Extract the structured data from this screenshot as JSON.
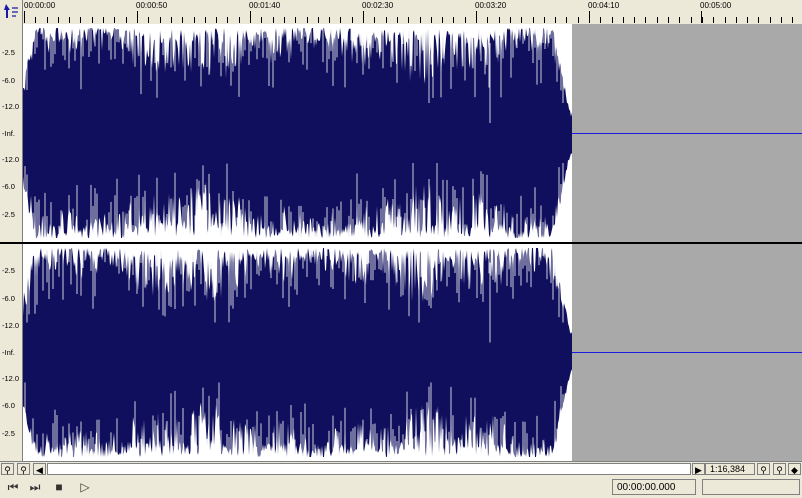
{
  "timeline": {
    "labels": [
      "00:00:00",
      "00:00:50",
      "00:01:40",
      "00:02:30",
      "00:03:20",
      "00:04:10",
      "00:05:00"
    ]
  },
  "db_scale": {
    "top": [
      "-2.5",
      "-6.0",
      "-12.0",
      "-Inf.",
      "-12.0",
      "-6.0",
      "-2.5"
    ],
    "bottom": [
      "-2.5",
      "-6.0",
      "-12.0",
      "-Inf.",
      "-12.0",
      "-6.0",
      "-2.5"
    ]
  },
  "zoom": {
    "label": "1:16,384"
  },
  "position": {
    "value": "00:00:00.000"
  },
  "colors": {
    "waveform": "#0f0f5e",
    "silence": "#a9a9a9",
    "baseline": "#1c1ce0",
    "chrome": "#ece9d8"
  },
  "icons": {
    "corner": "cursor-tool-icon",
    "zoom_in": "zoom-in-icon",
    "zoom_out": "zoom-out-icon",
    "scroll_left": "arrow-left-icon",
    "scroll_right": "arrow-right-icon",
    "go_start": "skip-start-icon",
    "go_end": "skip-end-icon",
    "stop": "stop-icon",
    "play": "play-icon"
  }
}
